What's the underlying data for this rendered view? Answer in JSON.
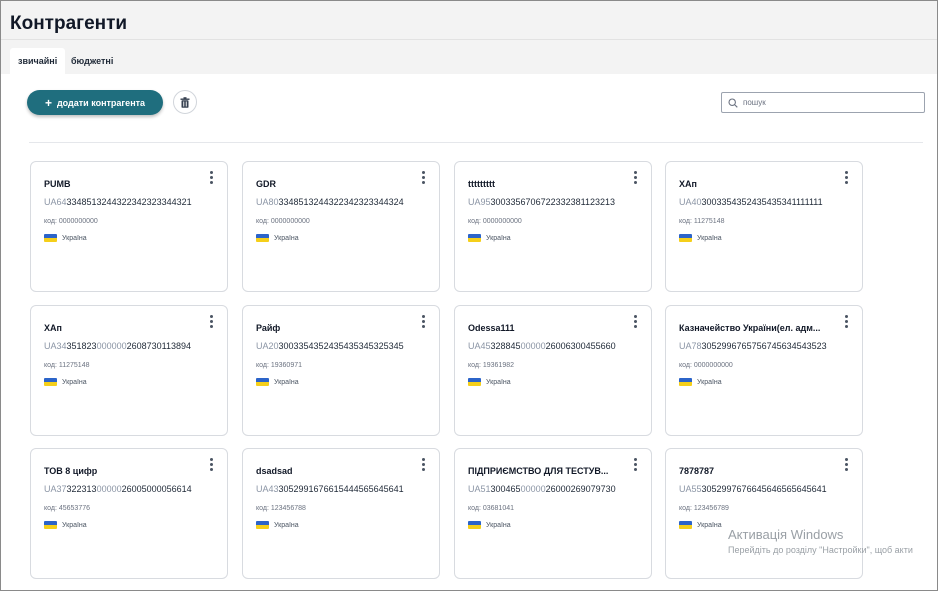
{
  "header": {
    "title": "Контрагенти"
  },
  "tabs": [
    {
      "label": "звичайні",
      "active": true
    },
    {
      "label": "бюджетні",
      "active": false
    }
  ],
  "toolbar": {
    "add_label": "додати контрагента",
    "search_placeholder": "пошук"
  },
  "cards": [
    {
      "name": "PUMB",
      "iban_prefix": "UA64",
      "iban_mid": "",
      "iban_rest": "3348513244322342323344321",
      "code": "код: 0000000000",
      "country": "Україна"
    },
    {
      "name": "GDR",
      "iban_prefix": "UA80",
      "iban_mid": "",
      "iban_rest": "3348513244322342323344324",
      "code": "код: 0000000000",
      "country": "Україна"
    },
    {
      "name": "ttttttttt",
      "iban_prefix": "UA95",
      "iban_mid": "",
      "iban_rest": "3003356706722332381123213",
      "code": "код: 0000000000",
      "country": "Україна"
    },
    {
      "name": "ХАп",
      "iban_prefix": "UA40",
      "iban_mid": "",
      "iban_rest": "3003354352435435341111111",
      "code": "код: 11275148",
      "country": "Україна"
    },
    {
      "name": "ХАп",
      "iban_prefix": "UA34",
      "iban_mid": "351823",
      "iban_muted": "000000",
      "iban_rest": "2608730113894",
      "code": "код: 11275148",
      "country": "Україна"
    },
    {
      "name": "Райф",
      "iban_prefix": "UA20",
      "iban_mid": "",
      "iban_rest": "3003354352435435345325345",
      "code": "код: 19360971",
      "country": "Україна"
    },
    {
      "name": "Odessa111",
      "iban_prefix": "UA45",
      "iban_mid": "328845",
      "iban_muted": "00000",
      "iban_rest": "26006300455660",
      "code": "код: 19361982",
      "country": "Україна"
    },
    {
      "name": "Казначейство України(ел. адм...",
      "iban_prefix": "UA78",
      "iban_mid": "",
      "iban_rest": "3052996765756745634543523",
      "code": "код: 0000000000",
      "country": "Україна"
    },
    {
      "name": "ТОВ 8 цифр",
      "iban_prefix": "UA37",
      "iban_mid": "322313",
      "iban_muted": "00000",
      "iban_rest": "26005000056614",
      "code": "код: 45653776",
      "country": "Україна"
    },
    {
      "name": "dsadsad",
      "iban_prefix": "UA43",
      "iban_mid": "",
      "iban_rest": "3052991676615444565645641",
      "code": "код: 123456788",
      "country": "Україна"
    },
    {
      "name": "ПІДПРИЄМСТВО ДЛЯ ТЕСТУВ...",
      "iban_prefix": "UA51",
      "iban_mid": "300465",
      "iban_muted": "00000",
      "iban_rest": "26000269079730",
      "code": "код: 03681041",
      "country": "Україна"
    },
    {
      "name": "7878787",
      "iban_prefix": "UA55",
      "iban_mid": "",
      "iban_rest": "3052997676645646565645641",
      "code": "код: 123456789",
      "country": "Україна"
    }
  ],
  "watermark": {
    "title": "Активація Windows",
    "subtitle": "Перейдіть до розділу \"Настройки\", щоб акти"
  },
  "colors": {
    "primary_button": "#1f6e7e",
    "flag_blue": "#2c64c9",
    "flag_yellow": "#f5cf1a"
  }
}
